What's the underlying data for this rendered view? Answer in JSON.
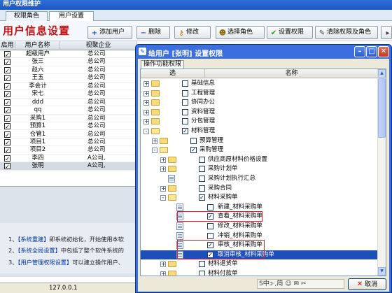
{
  "app_title": "用户权限维护",
  "app_tabs": [
    "权限角色",
    "用户设置"
  ],
  "page_title": "用户信息设置",
  "toolbar": {
    "add_user": "添加用户",
    "delete": "删除",
    "modify": "修改",
    "select_role": "选择角色",
    "set_permission": "设置权限",
    "clear_permission_and_role": "清除权限及角色"
  },
  "user_table": {
    "columns": [
      "启用",
      "用户名称",
      "视聚企业"
    ],
    "rows": [
      {
        "enabled": true,
        "name": "超级用户",
        "company": "总公司"
      },
      {
        "enabled": true,
        "name": "张三",
        "company": "总公司"
      },
      {
        "enabled": true,
        "name": "赵六",
        "company": "总公司"
      },
      {
        "enabled": true,
        "name": "王五",
        "company": "总公司"
      },
      {
        "enabled": true,
        "name": "李会计",
        "company": "总公司"
      },
      {
        "enabled": true,
        "name": "宋七",
        "company": "总公司"
      },
      {
        "enabled": true,
        "name": "ddd",
        "company": "总公司"
      },
      {
        "enabled": true,
        "name": "qq",
        "company": "总公司"
      },
      {
        "enabled": true,
        "name": "采购1",
        "company": "总公司"
      },
      {
        "enabled": true,
        "name": "预算1",
        "company": "总公司"
      },
      {
        "enabled": true,
        "name": "仓管1",
        "company": "总公司"
      },
      {
        "enabled": true,
        "name": "项目1",
        "company": "总公司"
      },
      {
        "enabled": true,
        "name": "项目2",
        "company": "总公司"
      },
      {
        "enabled": true,
        "name": "李四",
        "company": "A公司,"
      },
      {
        "enabled": true,
        "name": "张明",
        "company": "A公司,"
      }
    ],
    "selected_index": 14
  },
  "tips": [
    {
      "num": "1、",
      "label": "【系统重建】",
      "text": "即系统初始化，开始使用本软"
    },
    {
      "num": "2、",
      "label": "【系统全局设置】",
      "text": "中包括了整个软件系统的"
    },
    {
      "num": "3、",
      "label": "【用户管理权限设置】",
      "text": "可以建立操作用户、"
    }
  ],
  "status_bar": {
    "ip": "127.0.0.1"
  },
  "dialog": {
    "title": "给用户 [张明] 设置权限",
    "tab": "操作功能权限",
    "columns": [
      "选",
      "名称"
    ],
    "tree": [
      {
        "level": 0,
        "expander": "+",
        "icon": "folder",
        "checked": false,
        "label": "基础信息"
      },
      {
        "level": 0,
        "expander": "+",
        "icon": "folder",
        "checked": false,
        "label": "工程管理"
      },
      {
        "level": 0,
        "expander": "+",
        "icon": "folder",
        "checked": false,
        "label": "协同办公"
      },
      {
        "level": 0,
        "expander": "+",
        "icon": "folder",
        "checked": false,
        "label": "资料管理"
      },
      {
        "level": 0,
        "expander": "+",
        "icon": "folder",
        "checked": false,
        "label": "分包管理"
      },
      {
        "level": 0,
        "expander": "-",
        "icon": "folder-open",
        "checked": true,
        "label": "材料管理"
      },
      {
        "level": 1,
        "expander": "+",
        "icon": "folder",
        "checked": false,
        "label": "预算管理"
      },
      {
        "level": 1,
        "expander": "-",
        "icon": "folder-open",
        "checked": true,
        "label": "采购管理"
      },
      {
        "level": 2,
        "expander": "+",
        "icon": "folder",
        "checked": false,
        "label": "供应商原材料价格设置"
      },
      {
        "level": 2,
        "expander": "+",
        "icon": "folder",
        "checked": false,
        "label": "采购计划单"
      },
      {
        "level": 2,
        "expander": "",
        "icon": "page",
        "checked": false,
        "label": "采购计划执行汇总"
      },
      {
        "level": 2,
        "expander": "+",
        "icon": "folder",
        "checked": false,
        "label": "采购合同"
      },
      {
        "level": 2,
        "expander": "-",
        "icon": "folder-open",
        "checked": true,
        "label": "材料采购单"
      },
      {
        "level": 3,
        "expander": "",
        "icon": "page",
        "checked": false,
        "label": "新建_材料采购单"
      },
      {
        "level": 3,
        "expander": "",
        "icon": "page",
        "checked": true,
        "label": "查看_材料采购单"
      },
      {
        "level": 3,
        "expander": "",
        "icon": "page",
        "checked": false,
        "label": "修改_材料采购单"
      },
      {
        "level": 3,
        "expander": "",
        "icon": "page",
        "checked": false,
        "label": "冲销_材料采购单"
      },
      {
        "level": 3,
        "expander": "",
        "icon": "page",
        "checked": true,
        "label": "审核_材料采购单"
      },
      {
        "level": 3,
        "expander": "",
        "icon": "page",
        "checked": true,
        "label": "取消审核_材料采购单"
      },
      {
        "level": 2,
        "expander": "+",
        "icon": "folder",
        "checked": false,
        "label": "材料退货单"
      },
      {
        "level": 2,
        "expander": "+",
        "icon": "folder",
        "checked": false,
        "label": "材料付款单"
      }
    ],
    "highlighted_index": 18,
    "ime_text": "S中ↄ·,简 ☺ ✉ ✂",
    "cancel_label": "取消"
  },
  "colors": {
    "page_title": "#c51212",
    "titlebar": "#3c6fdd",
    "selected_row": "#1d4fb8",
    "annotation": "#e02020"
  }
}
